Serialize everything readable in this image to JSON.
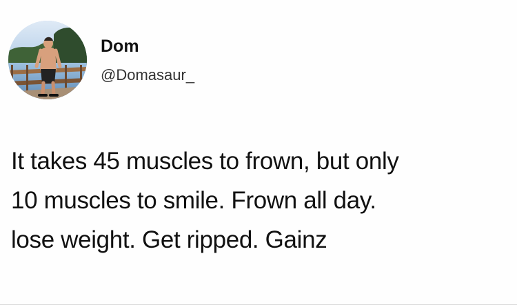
{
  "tweet": {
    "author": {
      "name": "Dom",
      "handle": "@Domasaur_",
      "avatar_icon": "profile-photo"
    },
    "text_lines": [
      "It takes 45 muscles to frown, but only",
      "10 muscles to smile. Frown all day.",
      "lose weight. Get ripped. Gainz"
    ]
  },
  "colors": {
    "background": "#ffffff",
    "text": "#111111",
    "handle_text": "#333333"
  }
}
